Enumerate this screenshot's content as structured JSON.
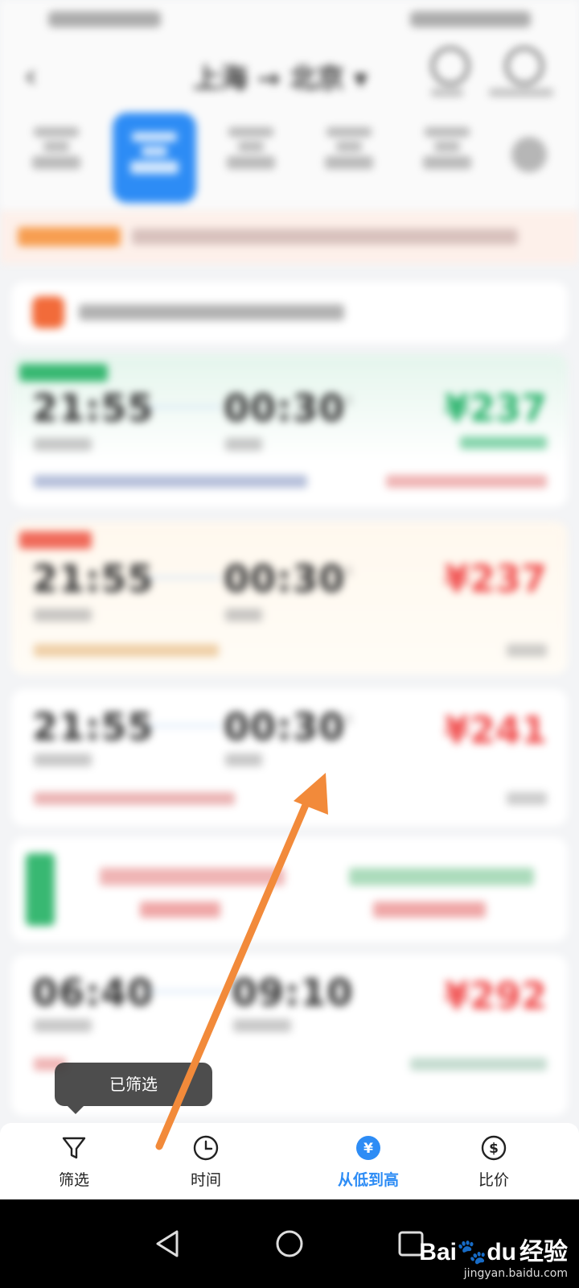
{
  "header": {
    "title": "上海 → 北京 ▾"
  },
  "sort_toast": {
    "text": "已筛选"
  },
  "bottom_nav": {
    "items": [
      {
        "label": "筛选",
        "icon": "filter-icon",
        "active": false
      },
      {
        "label": "时间",
        "icon": "clock-icon",
        "active": false
      },
      {
        "label": "从低到高",
        "icon": "yuan-icon",
        "active": true
      },
      {
        "label": "比价",
        "icon": "compare-price-icon",
        "active": false
      }
    ]
  },
  "flights": [
    {
      "dep_time": "21:55",
      "arr_time": "00:30",
      "next_day": "+1",
      "price": "¥237"
    },
    {
      "dep_time": "21:55",
      "arr_time": "00:30",
      "next_day": "+1",
      "price": "¥237"
    },
    {
      "dep_time": "21:55",
      "arr_time": "00:30",
      "next_day": "+1",
      "price": "¥241"
    },
    {
      "dep_time": "06:40",
      "arr_time": "09:10",
      "next_day": "",
      "price": "¥292"
    }
  ],
  "watermark": {
    "brand_a": "Bai",
    "brand_b": "du",
    "brand_cn": "经验",
    "url": "jingyan.baidu.com"
  },
  "colors": {
    "accent": "#2d8cf5",
    "price_red": "#f04a4a",
    "price_green": "#27b26a",
    "arrow": "#f28a3a"
  }
}
